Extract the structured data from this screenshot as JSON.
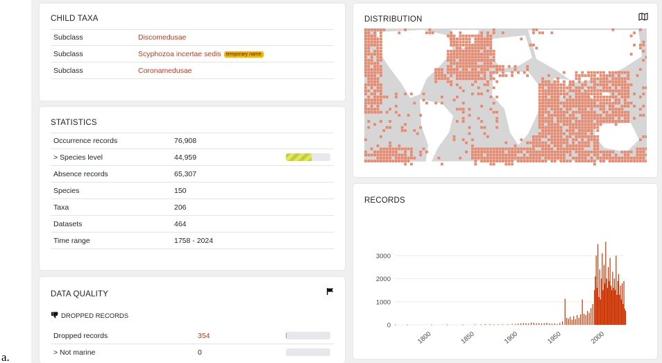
{
  "corner_label": "a.",
  "child_taxa": {
    "title": "CHILD TAXA",
    "rows": [
      {
        "rank": "Subclass",
        "name": "Discomedusae",
        "badge": ""
      },
      {
        "rank": "Subclass",
        "name": "Scyphozoa incertae sedis",
        "badge": "temporary name"
      },
      {
        "rank": "Subclass",
        "name": "Coronamedusae",
        "badge": ""
      }
    ]
  },
  "statistics": {
    "title": "STATISTICS",
    "rows": [
      {
        "label": "Occurrence records",
        "value": "76,908"
      },
      {
        "label": "> Species level",
        "value": "44,959",
        "bar_fraction": 0.58
      },
      {
        "label": "Absence records",
        "value": "65,307"
      },
      {
        "label": "Species",
        "value": "150"
      },
      {
        "label": "Taxa",
        "value": "206"
      },
      {
        "label": "Datasets",
        "value": "464"
      },
      {
        "label": "Time range",
        "value": "1758 - 2024"
      }
    ]
  },
  "data_quality": {
    "title": "DATA QUALITY",
    "subtitle": "DROPPED RECORDS",
    "rows": [
      {
        "label": "Dropped records",
        "value": "354",
        "bar_fraction": 0.01
      },
      {
        "label": "> Not marine",
        "value": "0",
        "bar_fraction": 0
      }
    ]
  },
  "distribution": {
    "title": "DISTRIBUTION",
    "icon": "map-icon",
    "cell_color": "#e8896e",
    "land_color": "#ffffff",
    "ocean_color": "#d6d6d6"
  },
  "records": {
    "title": "RECORDS"
  },
  "chart_data": {
    "type": "bar",
    "title": "RECORDS",
    "xlabel": "",
    "ylabel": "",
    "x_ticks": [
      "1800",
      "1850",
      "1900",
      "1950",
      "2000"
    ],
    "y_ticks": [
      "0",
      "1000",
      "2000",
      "3000"
    ],
    "xlim": [
      1758,
      2024
    ],
    "ylim": [
      0,
      3700
    ],
    "color": "#cc3300",
    "x": [
      1758,
      1772,
      1800,
      1818,
      1836,
      1850,
      1857,
      1862,
      1867,
      1872,
      1877,
      1882,
      1888,
      1893,
      1897,
      1900,
      1903,
      1906,
      1909,
      1912,
      1915,
      1918,
      1921,
      1924,
      1927,
      1930,
      1933,
      1936,
      1939,
      1942,
      1945,
      1948,
      1951,
      1954,
      1956,
      1958,
      1960,
      1962,
      1964,
      1966,
      1968,
      1970,
      1972,
      1974,
      1976,
      1978,
      1980,
      1982,
      1984,
      1986,
      1988,
      1989,
      1990,
      1991,
      1992,
      1993,
      1994,
      1995,
      1996,
      1997,
      1998,
      1999,
      2000,
      2001,
      2002,
      2003,
      2004,
      2005,
      2006,
      2007,
      2008,
      2009,
      2010,
      2011,
      2012,
      2013,
      2014,
      2015,
      2016,
      2017,
      2018,
      2019,
      2020,
      2021,
      2022,
      2023,
      2024
    ],
    "values": [
      10,
      12,
      8,
      15,
      10,
      20,
      14,
      30,
      25,
      12,
      18,
      20,
      25,
      30,
      40,
      50,
      60,
      80,
      70,
      60,
      100,
      90,
      70,
      80,
      60,
      70,
      90,
      60,
      50,
      60,
      40,
      80,
      150,
      1130,
      300,
      260,
      350,
      220,
      380,
      250,
      420,
      300,
      450,
      1100,
      480,
      420,
      600,
      520,
      720,
      900,
      1500,
      2100,
      3000,
      1600,
      3500,
      1200,
      2400,
      1100,
      2000,
      3100,
      1500,
      2600,
      1800,
      3600,
      2000,
      1600,
      2500,
      1900,
      2900,
      1700,
      1500,
      2300,
      1600,
      2000,
      1500,
      3000,
      1300,
      1900,
      2200,
      1300,
      1700,
      1100,
      1800,
      900,
      1900,
      700,
      600
    ]
  }
}
